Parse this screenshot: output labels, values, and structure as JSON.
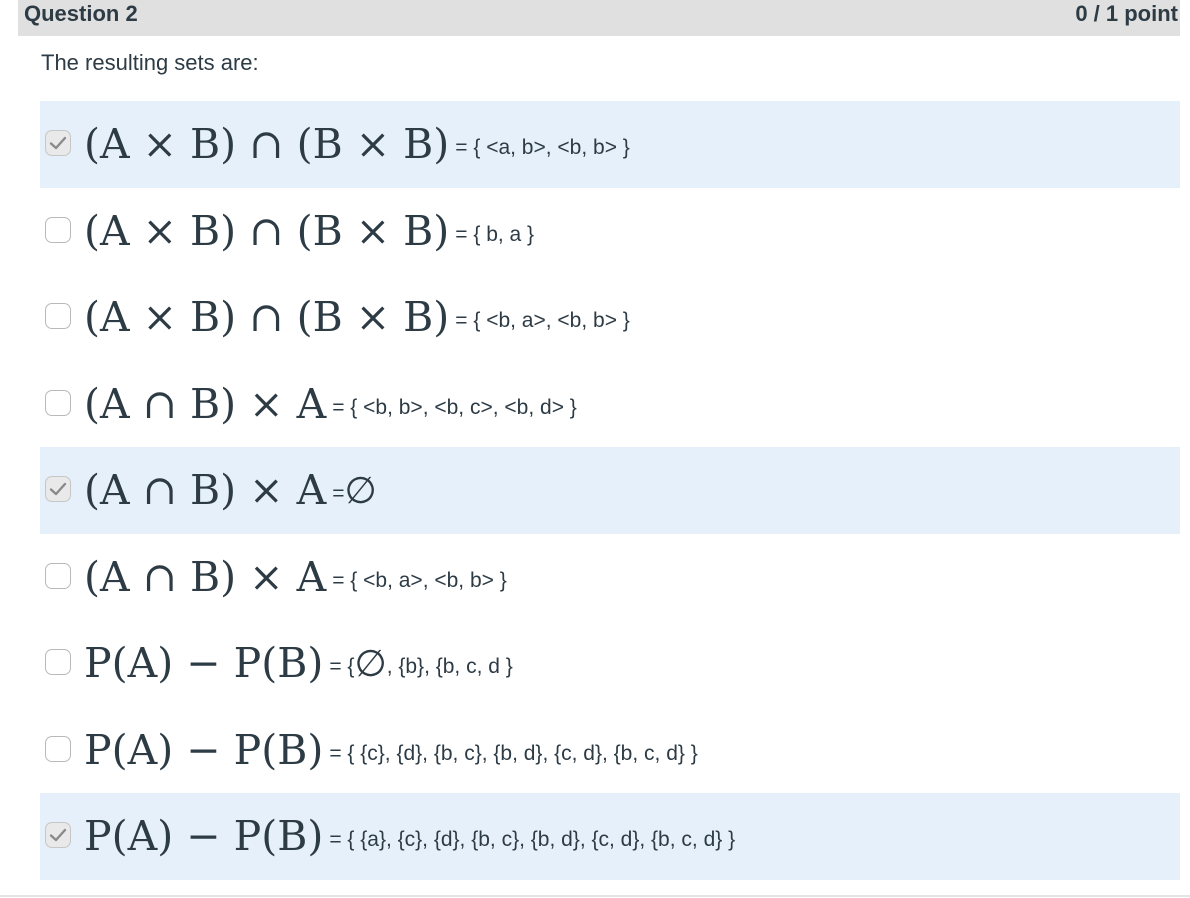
{
  "question": {
    "title": "Question 2",
    "points": "0 / 1 point",
    "prompt": "The resulting sets are:"
  },
  "options": [
    {
      "expr": "(A × B) ∩ (B × B)",
      "set_text": "= { <a, b>, <b, b> }",
      "checked": true
    },
    {
      "expr": "(A × B) ∩ (B × B)",
      "set_text": "= {  b, a }",
      "checked": false
    },
    {
      "expr": "(A × B) ∩ (B × B)",
      "set_text": "= { <b, a>, <b, b> }",
      "checked": false
    },
    {
      "expr": "(A ∩ B) × A",
      "set_text": "= { <b, b>, <b, c>, <b, d> }",
      "checked": false
    },
    {
      "expr": "(A ∩ B) × A",
      "set_text": "=",
      "set_suffix": "∅",
      "checked": true
    },
    {
      "expr": "(A ∩ B) × A",
      "set_text": "= { <b, a>, <b, b> }",
      "checked": false
    },
    {
      "expr": "P(A) − P(B)",
      "set_text": "= {",
      "set_suffix": "∅",
      "set_tail": ", {b}, {b, c, d }",
      "checked": false
    },
    {
      "expr": "P(A) − P(B)",
      "set_text": "= { {c}, {d}, {b, c}, {b, d}, {c, d}, {b, c, d} }",
      "checked": false
    },
    {
      "expr": "P(A) − P(B)",
      "set_text": "= { {a}, {c}, {d}, {b, c}, {b, d}, {c, d}, {b, c, d} }",
      "checked": true
    }
  ],
  "colors": {
    "selected_row_bg": "#e6f0fa",
    "header_bg": "#e0e0e0",
    "text": "#2d3b45"
  }
}
